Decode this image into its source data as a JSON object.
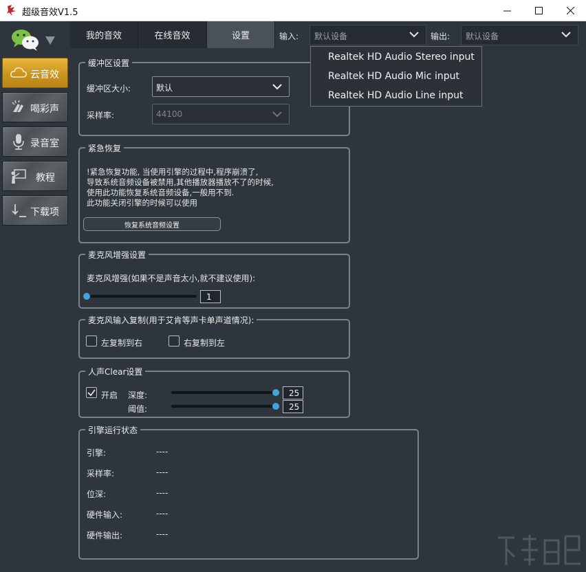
{
  "window": {
    "title": "超级音效V1.5",
    "controls": {
      "minimize": "minimize-icon",
      "maximize": "maximize-icon",
      "close": "close-icon"
    }
  },
  "sidebar": {
    "items": [
      {
        "label": "云音效",
        "icon": "cloud-icon",
        "active": true
      },
      {
        "label": "喝彩声",
        "icon": "applause-icon",
        "active": false
      },
      {
        "label": "录音室",
        "icon": "microphone-icon",
        "active": false
      },
      {
        "label": "教程",
        "icon": "tutorial-icon",
        "active": false
      },
      {
        "label": "下载项",
        "icon": "download-icon",
        "active": false
      }
    ]
  },
  "tabs": [
    {
      "label": "我的音效",
      "active": false
    },
    {
      "label": "在线音效",
      "active": false
    },
    {
      "label": "设置",
      "active": true
    }
  ],
  "io": {
    "input_label": "输入:",
    "input_value": "默认设备",
    "output_label": "输出:",
    "output_value": "默认设备"
  },
  "input_dropdown": {
    "options": [
      "Realtek HD Audio Stereo input",
      "Realtek HD Audio Mic input",
      "Realtek HD Audio Line input"
    ]
  },
  "buffer": {
    "title": "缓冲区设置",
    "size_label": "缓冲区大小:",
    "size_value": "默认",
    "rate_label": "采样率:",
    "rate_value": "44100"
  },
  "recovery": {
    "title": "紧急恢复",
    "lines": [
      "!紧急恢复功能, 当使用引擎的过程中,程序崩溃了,",
      "导致系统音频设备被禁用,其他播放器播放不了的时候,",
      "使用此功能恢复系统音频设备,一般用不到.",
      "此功能关闭引擎的时候可以使用"
    ],
    "button": "恢复系统音频设置"
  },
  "mic_boost": {
    "title": "麦克风增强设置",
    "label": "麦克风增强(如果不是声音太小,就不建议使用):",
    "value": "1",
    "level": 0
  },
  "mic_copy": {
    "title": "麦克风输入复制(用于艾肯等声卡单声道情况):",
    "left_to_right": "左复制到右",
    "right_to_left": "右复制到左",
    "left_checked": false,
    "right_checked": false
  },
  "clear": {
    "title": "人声Clear设置",
    "enable_label": "开启",
    "enabled": true,
    "depth_label": "深度:",
    "depth_value": "25",
    "depth_level": 1.0,
    "threshold_label": "阈值:",
    "threshold_value": "25",
    "threshold_level": 1.0
  },
  "engine_status": {
    "title": "引擎运行状态",
    "rows": [
      {
        "label": "引擎:",
        "value": "----"
      },
      {
        "label": "采样率:",
        "value": "----"
      },
      {
        "label": "位深:",
        "value": "----"
      },
      {
        "label": "硬件输入:",
        "value": "----"
      },
      {
        "label": "硬件输出:",
        "value": "----"
      }
    ]
  },
  "colors": {
    "background": "#2e353d",
    "accent_gold": "#d9a22a",
    "slider_blue": "#41a6d8"
  }
}
